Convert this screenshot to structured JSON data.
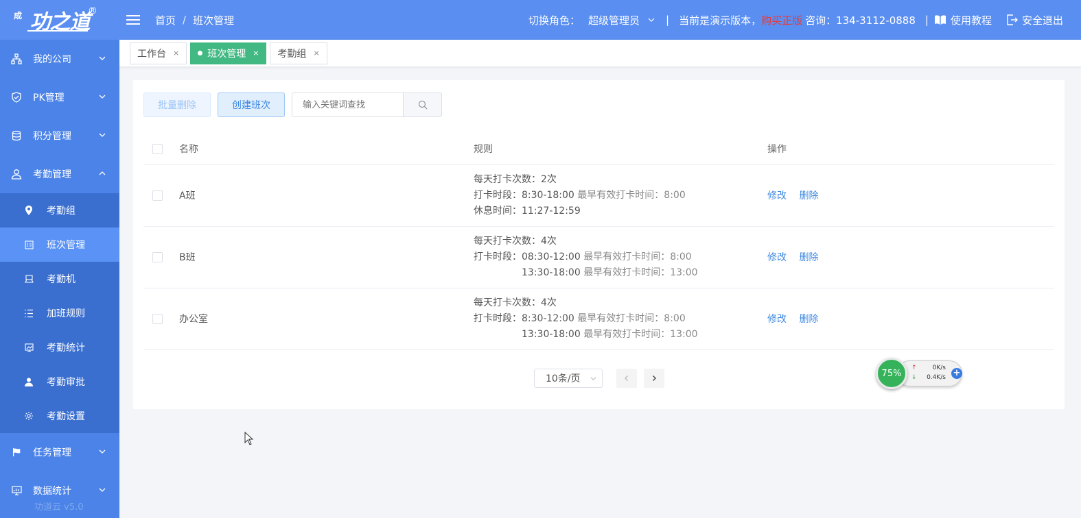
{
  "brand": {
    "logo_text": "功之道",
    "logo_small": "成",
    "registered": "®",
    "version": "功道云 v5.0"
  },
  "sidebar": {
    "items": [
      {
        "label": "我的公司",
        "icon": "org-icon"
      },
      {
        "label": "PK管理",
        "icon": "shield-icon"
      },
      {
        "label": "积分管理",
        "icon": "database-icon"
      },
      {
        "label": "考勤管理",
        "icon": "user-icon"
      },
      {
        "label": "任务管理",
        "icon": "flag-icon"
      },
      {
        "label": "数据统计",
        "icon": "chart-icon"
      }
    ],
    "sub_items": [
      {
        "label": "考勤组",
        "icon": "location-icon"
      },
      {
        "label": "班次管理",
        "icon": "calendar-icon"
      },
      {
        "label": "考勤机",
        "icon": "device-icon"
      },
      {
        "label": "加班规则",
        "icon": "list-icon"
      },
      {
        "label": "考勤统计",
        "icon": "stats-icon"
      },
      {
        "label": "考勤审批",
        "icon": "person-icon"
      },
      {
        "label": "考勤设置",
        "icon": "gear-icon"
      }
    ]
  },
  "header": {
    "breadcrumb_home": "首页",
    "breadcrumb_sep": "/",
    "breadcrumb_current": "班次管理",
    "role_label": "切换角色：",
    "role_value": "超级管理员",
    "pipe": "|",
    "demo_text": "当前是演示版本，",
    "buy_text": "购买正版",
    "consult_text": "咨询：134-3112-0888",
    "pipe2": "|",
    "tutorial": "使用教程",
    "logout": "安全退出"
  },
  "tabs": [
    {
      "label": "工作台",
      "close": "×"
    },
    {
      "label": "班次管理",
      "close": "×"
    },
    {
      "label": "考勤组",
      "close": "×"
    }
  ],
  "toolbar": {
    "batch_delete": "批量删除",
    "create": "创建班次",
    "search_placeholder": "输入关键词查找"
  },
  "table": {
    "headers": {
      "name": "名称",
      "rule": "规则",
      "op": "操作"
    },
    "rows": [
      {
        "name": "A班",
        "line1": "每天打卡次数：2次",
        "line2_label": "打卡时段：",
        "line2_time": "8:30-18:00",
        "line2_muted": " 最早有效打卡时间：8:00",
        "line3_plain": "休息时间：11:27-12:59",
        "edit": "修改",
        "del": "删除"
      },
      {
        "name": "B班",
        "line1": "每天打卡次数：4次",
        "line2_label": "打卡时段：",
        "line2_time": "08:30-12:00",
        "line2_muted": " 最早有效打卡时间：8:00",
        "line3_time": "13:30-18:00",
        "line3_muted": " 最早有效打卡时间：13:00",
        "edit": "修改",
        "del": "删除"
      },
      {
        "name": "办公室",
        "line1": "每天打卡次数：4次",
        "line2_label": "打卡时段：",
        "line2_time": "8:30-12:00",
        "line2_muted": " 最早有效打卡时间：8:00",
        "line3_time": "13:30-18:00",
        "line3_muted": " 最早有效打卡时间：13:00",
        "edit": "修改",
        "del": "删除"
      }
    ]
  },
  "pager": {
    "page_size": "10条/页"
  },
  "widget": {
    "percent": "75%",
    "up": "0K/s",
    "down": "0.4K/s",
    "plus": "+",
    "up_arrow": "↑",
    "down_arrow": "↓"
  },
  "colors": {
    "primary": "#5a8ef0",
    "sidebar": "#4b83e8",
    "active_tab": "#42b983",
    "link": "#3e88e0",
    "buy": "#e53b3b"
  }
}
